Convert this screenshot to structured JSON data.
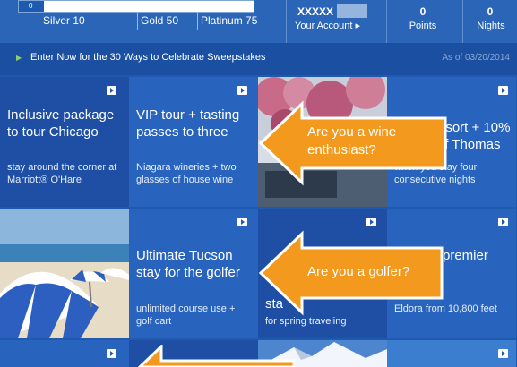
{
  "status": {
    "progress_label": "0",
    "progress_value": 0,
    "tiers": [
      "Silver 10",
      "Gold 50",
      "Platinum 75"
    ],
    "account_id": "XXXXX",
    "account_link": "Your Account ▸",
    "points_value": "0",
    "points_label": "Points",
    "nights_value": "0",
    "nights_label": "Nights"
  },
  "promo": {
    "text": "Enter Now for the 30 Ways to Celebrate Sweepstakes",
    "date": "As of 03/20/2014"
  },
  "tiles": [
    {
      "title": "Inclusive package to tour Chicago",
      "subtitle": "stay around the corner at Marriott® O'Hare"
    },
    {
      "title": "VIP tour + tasting passes to three",
      "subtitle": "Niagara wineries + two glasses of house wine"
    },
    {
      "title": "resort + 10% off Thomas",
      "subtitle": "when you stay four consecutive nights"
    },
    {
      "title": "Ultimate Tucson stay for the golfer",
      "subtitle": "unlimited course use + golf cart"
    },
    {
      "title": "sta",
      "subtitle": "for spring traveling"
    },
    {
      "title": "premier",
      "subtitle": "Eldora from 10,800 feet"
    }
  ],
  "callouts": [
    "Are you a wine enthusiast?",
    "Are you a golfer?"
  ],
  "colors": {
    "header_blue": "#2a65b8",
    "promo_blue": "#1b4fa2",
    "tile_blue": "#1e4fa5",
    "callout_orange": "#f39a1e"
  }
}
